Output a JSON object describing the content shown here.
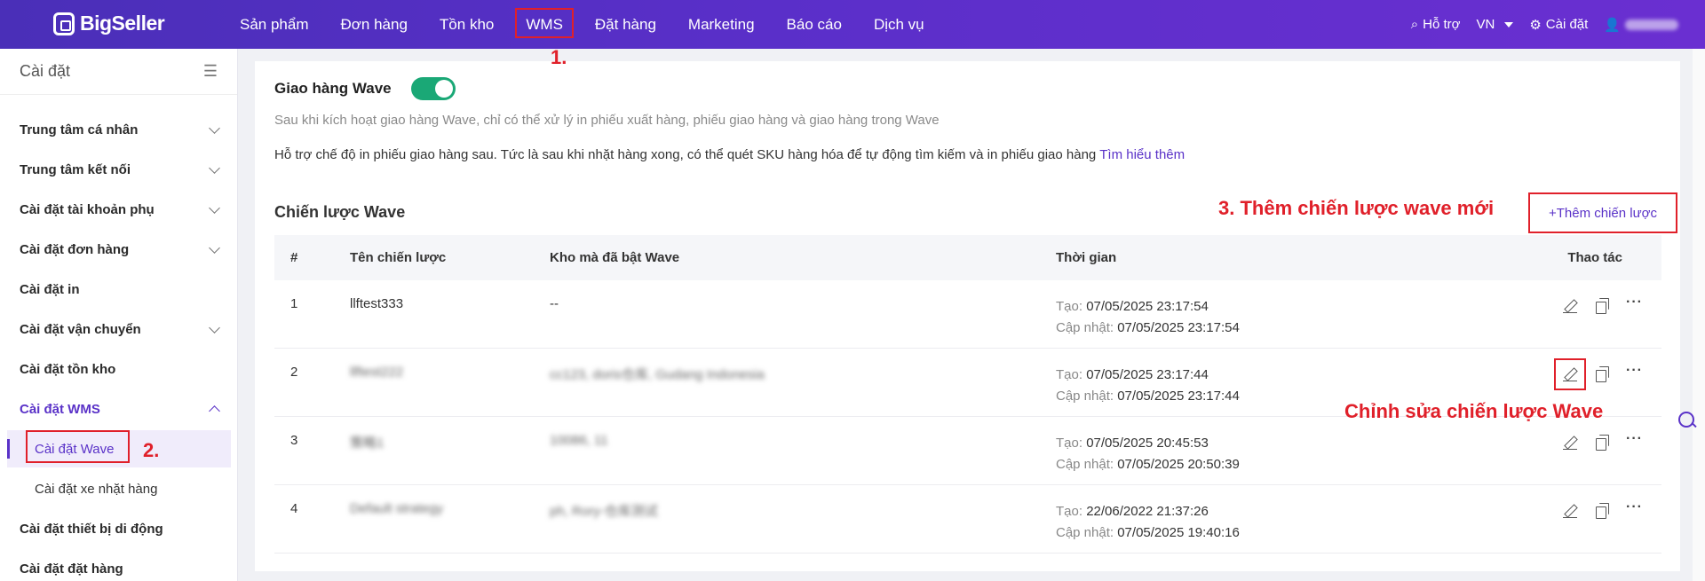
{
  "brand": {
    "name": "BigSeller"
  },
  "topnav": {
    "items": [
      {
        "label": "Sản phẩm"
      },
      {
        "label": "Đơn hàng"
      },
      {
        "label": "Tồn kho"
      },
      {
        "label": "WMS"
      },
      {
        "label": "Đặt hàng"
      },
      {
        "label": "Marketing"
      },
      {
        "label": "Báo cáo"
      },
      {
        "label": "Dịch vụ"
      }
    ],
    "help": "Hỗ trợ",
    "lang": "VN",
    "settings": "Cài đặt"
  },
  "sidebar": {
    "title": "Cài đặt",
    "items": [
      {
        "label": "Trung tâm cá nhân"
      },
      {
        "label": "Trung tâm kết nối"
      },
      {
        "label": "Cài đặt tài khoản phụ"
      },
      {
        "label": "Cài đặt đơn hàng"
      },
      {
        "label": "Cài đặt in"
      },
      {
        "label": "Cài đặt vận chuyển"
      },
      {
        "label": "Cài đặt tồn kho"
      },
      {
        "label": "Cài đặt WMS"
      },
      {
        "label": "Cài đặt thiết bị di động"
      },
      {
        "label": "Cài đặt đặt hàng"
      }
    ],
    "sub": [
      {
        "label": "Cài đặt Wave"
      },
      {
        "label": "Cài đặt xe nhặt hàng"
      }
    ]
  },
  "main": {
    "toggle_label": "Giao hàng Wave",
    "toggle_on": true,
    "desc1": "Sau khi kích hoạt giao hàng Wave, chỉ có thể xử lý in phiếu xuất hàng, phiếu giao hàng và giao hàng trong Wave",
    "desc2": "Hỗ trợ chế độ in phiếu giao hàng sau. Tức là sau khi nhặt hàng xong, có thể quét SKU hàng hóa để tự động tìm kiếm và in phiếu giao hàng",
    "learn_more": "Tìm hiểu thêm",
    "section_title": "Chiến lược Wave",
    "add_button": "+Thêm chiến lược",
    "columns": [
      "#",
      "Tên chiến lược",
      "Kho mà đã bật Wave",
      "Thời gian",
      "Thao tác"
    ],
    "created_label": "Tạo:",
    "updated_label": "Cập nhật:",
    "rows": [
      {
        "num": "1",
        "name": "llftest333",
        "warehouse": "--",
        "created": "07/05/2025 23:17:54",
        "updated": "07/05/2025 23:17:54"
      },
      {
        "num": "2",
        "name": "llftest222",
        "warehouse": "cc123, doris仓库, Gudang Indonesia",
        "created": "07/05/2025 23:17:44",
        "updated": "07/05/2025 23:17:44"
      },
      {
        "num": "3",
        "name": "策略1",
        "warehouse": "10086, 11",
        "created": "07/05/2025 20:45:53",
        "updated": "07/05/2025 20:50:39"
      },
      {
        "num": "4",
        "name": "Default strategy",
        "warehouse": "ph, Rory-仓库测试",
        "created": "22/06/2022 21:37:26",
        "updated": "07/05/2025 19:40:16"
      }
    ]
  },
  "annotations": {
    "a1": "1.",
    "a2": "2.",
    "a3": "3. Thêm chiến lược wave mới",
    "a4": "Chỉnh sửa chiến lược  Wave"
  }
}
